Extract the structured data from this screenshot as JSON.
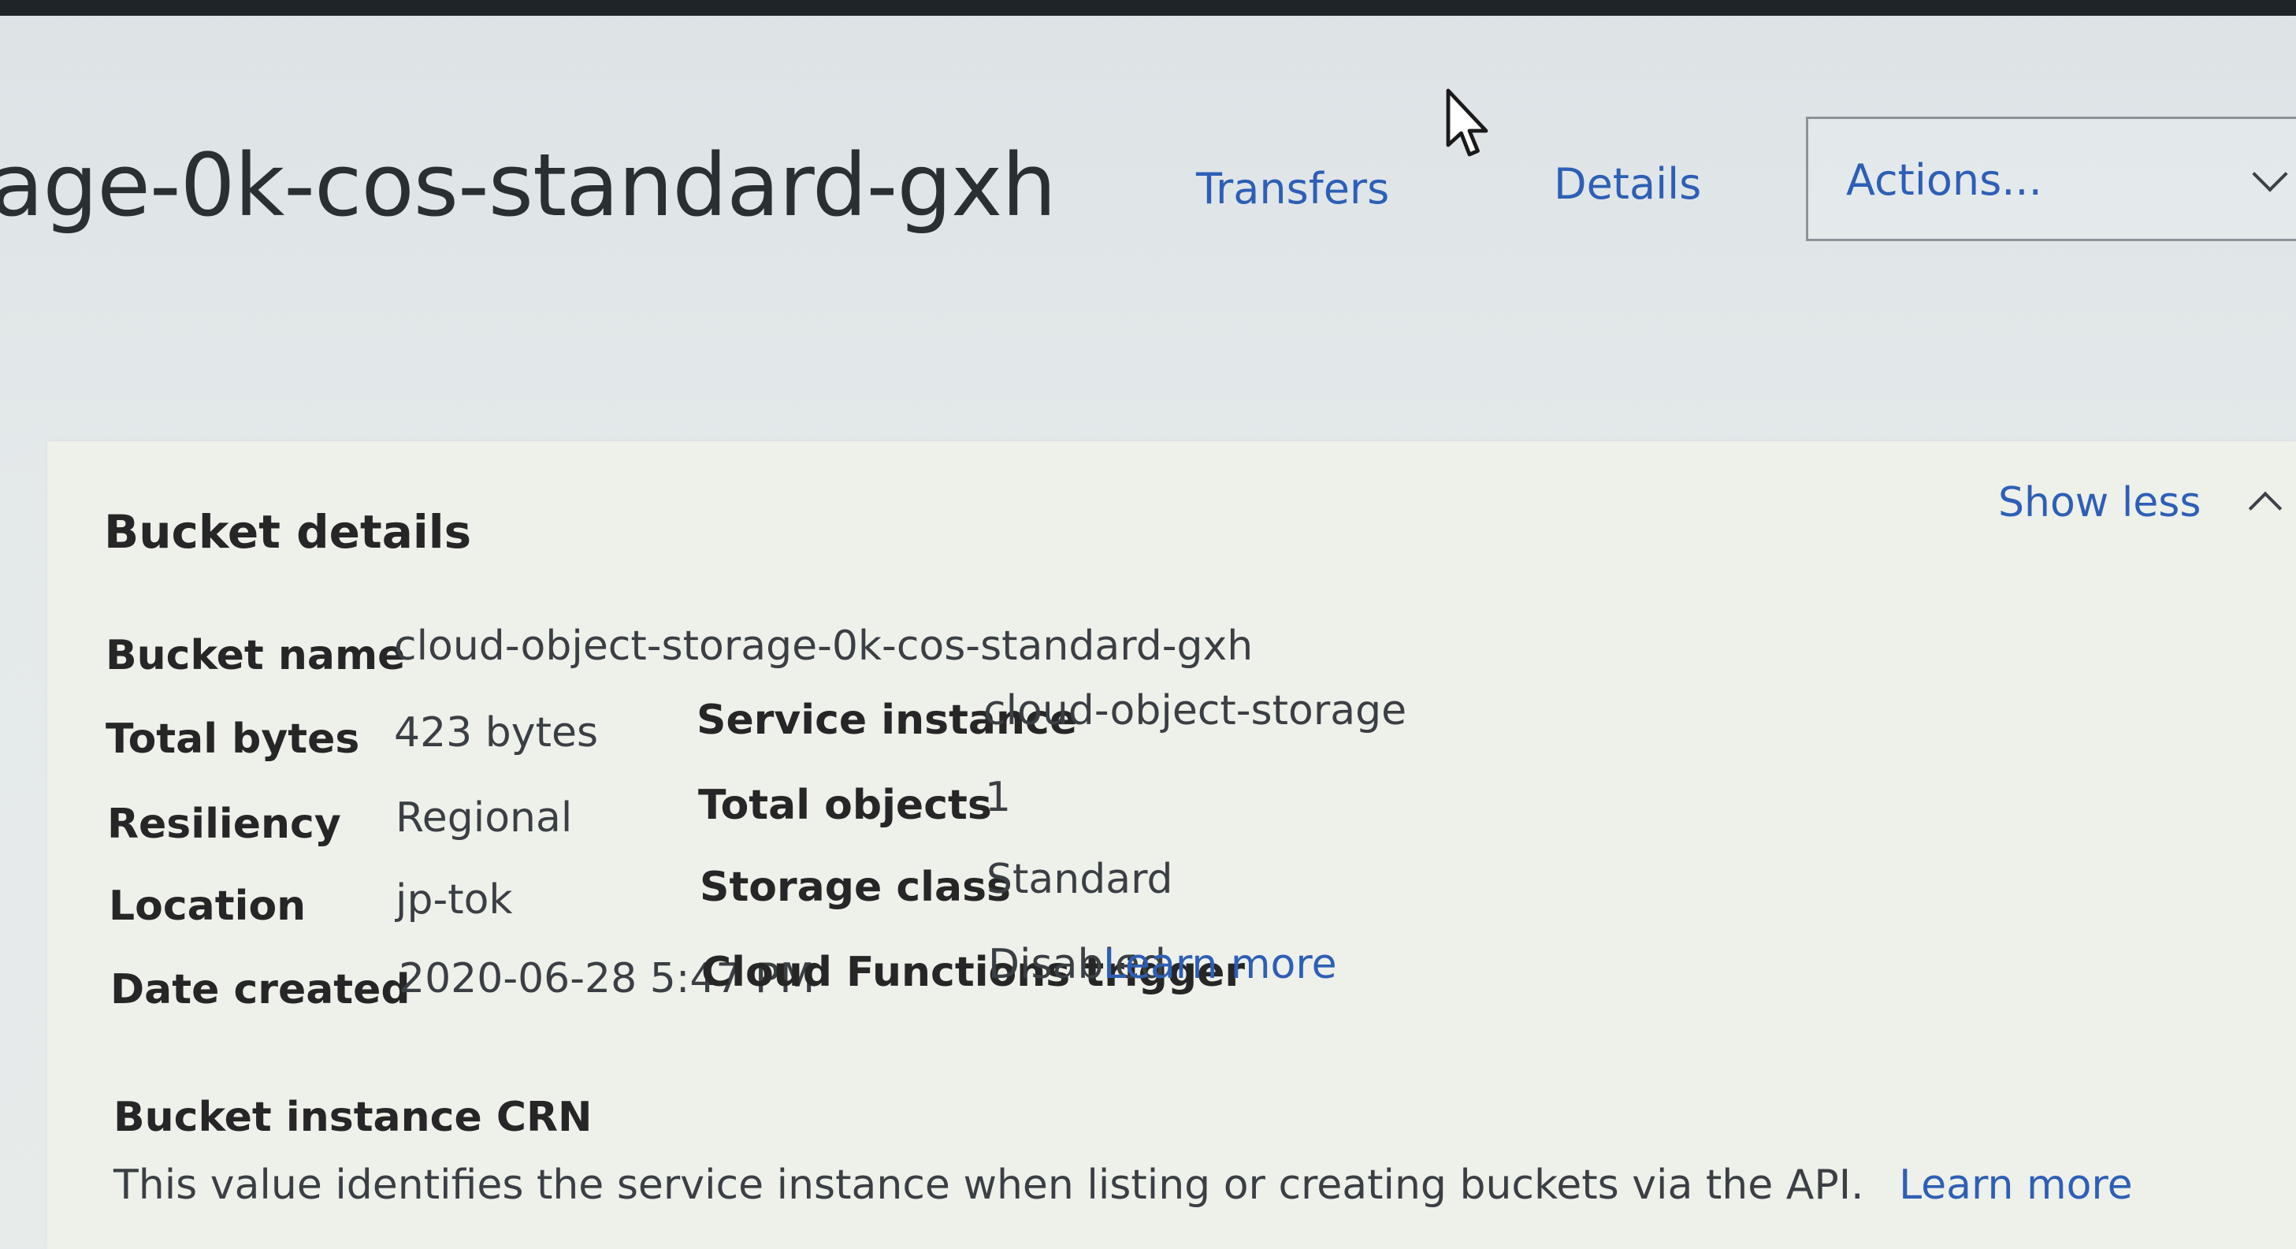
{
  "header": {
    "title": "age-0k-cos-standard-gxh",
    "nav": {
      "transfers": "Transfers",
      "details": "Details"
    },
    "actions": {
      "label": "Actions..."
    }
  },
  "panel": {
    "title": "Bucket details",
    "toggle_label": "Show less",
    "left": [
      {
        "label": "Bucket name",
        "value": "cloud-object-storage-0k-cos-standard-gxh"
      },
      {
        "label": "Total bytes",
        "value": "423 bytes"
      },
      {
        "label": "Resiliency",
        "value": "Regional"
      },
      {
        "label": "Location",
        "value": "jp-tok"
      },
      {
        "label": "Date created",
        "value": "2020-06-28 5:47 PM"
      }
    ],
    "right": [
      {
        "label": "Service instance",
        "value": "cloud-object-storage"
      },
      {
        "label": "Total objects",
        "value": "1"
      },
      {
        "label": "Storage class",
        "value": "Standard"
      },
      {
        "label": "Cloud Functions trigger",
        "value": "Disabled",
        "link": "Learn more"
      }
    ],
    "crn": {
      "title": "Bucket instance CRN",
      "description": "This value identifies the service instance when listing or creating buckets via the API.",
      "link": "Learn more"
    }
  },
  "icons": {
    "cursor": "mouse-pointer-icon",
    "actions_chevron": "chevron-down-icon",
    "toggle_chevron": "chevron-up-icon"
  },
  "colors": {
    "link": "#2d5fb6",
    "text": "#262626",
    "panel_bg": "#eef0ea",
    "page_bg": "#e4e9ea"
  }
}
